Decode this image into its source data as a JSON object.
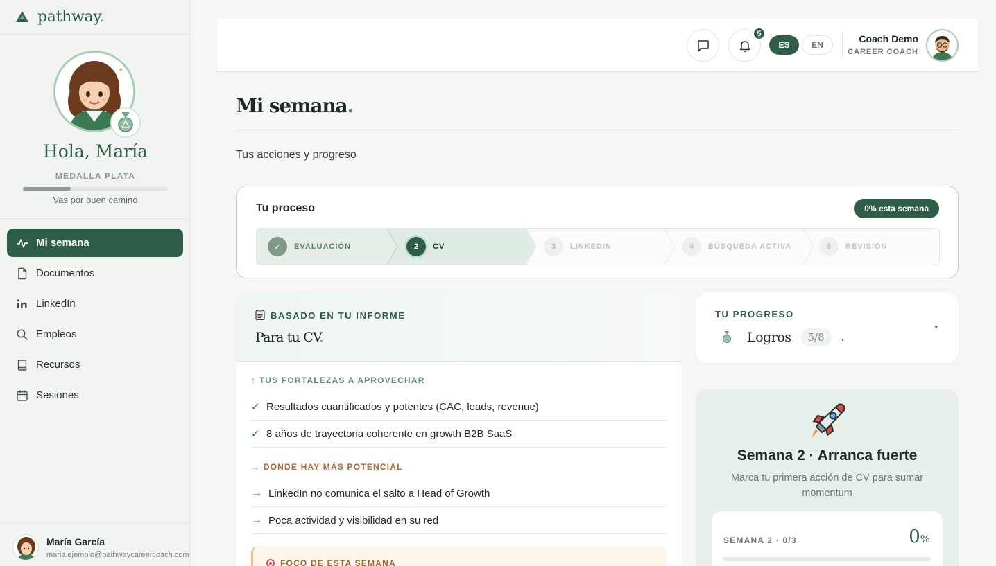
{
  "brand": {
    "name": "pathway",
    "dot": "."
  },
  "profile": {
    "greeting": "Hola, María",
    "medal": "MEDALLA PLATA",
    "medal_progress": 0.33,
    "status": "Vas por buen camino"
  },
  "nav": {
    "items": [
      {
        "label": "Mi semana",
        "icon": "activity-icon",
        "active": true
      },
      {
        "label": "Documentos",
        "icon": "document-icon",
        "active": false
      },
      {
        "label": "LinkedIn",
        "icon": "linkedin-icon",
        "active": false
      },
      {
        "label": "Empleos",
        "icon": "search-icon",
        "active": false
      },
      {
        "label": "Recursos",
        "icon": "book-icon",
        "active": false
      },
      {
        "label": "Sesiones",
        "icon": "calendar-icon",
        "active": false
      }
    ]
  },
  "user": {
    "name": "María García",
    "email": "maria.ejemplo@pathwaycareercoach.com"
  },
  "topbar": {
    "notifications": "5",
    "lang_es": "ES",
    "lang_en": "EN",
    "coach_name": "Coach Demo",
    "coach_role": "CAREER COACH"
  },
  "page": {
    "title": "Mi semana",
    "title_dot": ".",
    "subtitle": "Tus acciones y progreso"
  },
  "process": {
    "title": "Tu proceso",
    "badge": "0% esta semana",
    "steps": [
      {
        "num": "✓",
        "label": "EVALUACIÓN",
        "state": "done"
      },
      {
        "num": "2",
        "label": "CV",
        "state": "current"
      },
      {
        "num": "3",
        "label": "LINKEDIN",
        "state": "todo"
      },
      {
        "num": "4",
        "label": "BÚSQUEDA ACTIVA",
        "state": "todo"
      },
      {
        "num": "5",
        "label": "REVISIÓN",
        "state": "todo"
      }
    ]
  },
  "report": {
    "kicker": "BASADO EN TU INFORME",
    "title": "Para tu CV",
    "title_dot": ".",
    "strengths_head": "↑ TUS FORTALEZAS A APROVECHAR",
    "strengths": [
      "Resultados cuantificados y potentes (CAC, leads, revenue)",
      "8 años de trayectoria coherente en growth B2B SaaS"
    ],
    "potential_head": "→ DONDE HAY MÁS POTENCIAL",
    "potential": [
      "LinkedIn no comunica el salto a Head of Growth",
      "Poca actividad y visibilidad en su red"
    ],
    "focus_label": "FOCO DE ESTA SEMANA",
    "check_mark": "✓",
    "arrow_mark": "→"
  },
  "progress": {
    "kicker": "TU PROGRESO",
    "title": "Logros",
    "count": "5/8",
    "trailing": ".",
    "caret": "▾"
  },
  "week": {
    "title": "Semana 2 · Arranca fuerte",
    "subtitle": "Marca tu primera acción de CV para sumar momentum",
    "label": "SEMANA 2 · 0/3",
    "pct": "0",
    "pct_unit": "%",
    "progress": 0
  },
  "colors": {
    "primary": "#2e5e47",
    "accent": "#5a9e79",
    "orange": "#b4652f",
    "bg": "#f6f7f5"
  }
}
